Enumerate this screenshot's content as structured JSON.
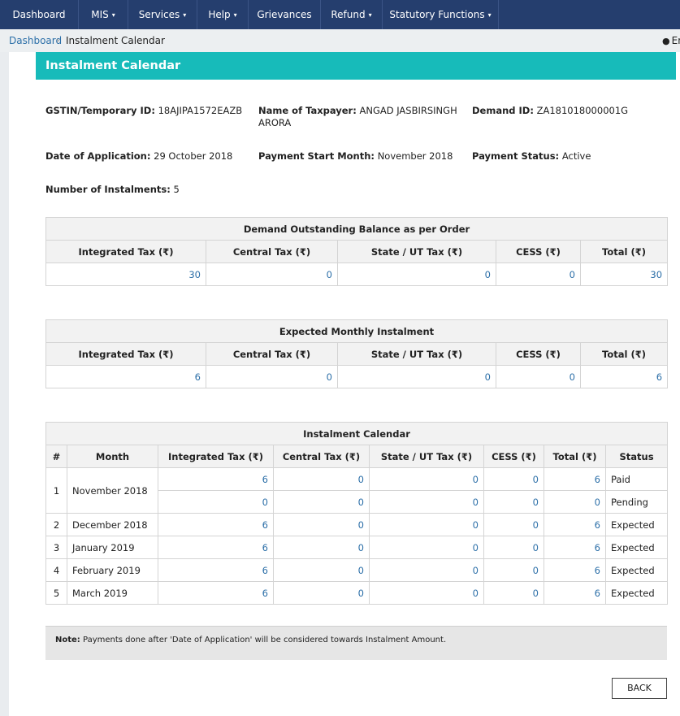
{
  "nav": {
    "items": [
      {
        "label": "Dashboard",
        "caret": false
      },
      {
        "label": "MIS",
        "caret": true
      },
      {
        "label": "Services",
        "caret": true
      },
      {
        "label": "Help",
        "caret": true
      },
      {
        "label": "Grievances",
        "caret": false
      },
      {
        "label": "Refund",
        "caret": true
      },
      {
        "label": "Statutory Functions",
        "caret": true
      }
    ],
    "caret_glyph": "▾"
  },
  "breadcrumb": {
    "link": "Dashboard",
    "separator": "›",
    "current": "Instalment Calendar"
  },
  "language": {
    "label": "En"
  },
  "page_title": "Instalment Calendar",
  "details": {
    "gstin": {
      "label": "GSTIN/Temporary ID:",
      "value": "18AJIPA1572EAZB"
    },
    "taxpayer": {
      "label": "Name of Taxpayer:",
      "value": "ANGAD JASBIRSINGH ARORA"
    },
    "demand_id": {
      "label": "Demand ID:",
      "value": "ZA181018000001G"
    },
    "date_of_application": {
      "label": "Date of Application:",
      "value": "29 October 2018"
    },
    "payment_start_month": {
      "label": "Payment Start Month:",
      "value": "November 2018"
    },
    "payment_status": {
      "label": "Payment Status:",
      "value": "Active"
    },
    "number_of_instalments": {
      "label": "Number of Instalments:",
      "value": "5"
    }
  },
  "tax_columns": [
    "Integrated Tax (₹)",
    "Central Tax (₹)",
    "State / UT Tax (₹)",
    "CESS (₹)",
    "Total (₹)"
  ],
  "outstanding": {
    "title": "Demand Outstanding Balance as per Order",
    "values": [
      "30",
      "0",
      "0",
      "0",
      "30"
    ]
  },
  "monthly": {
    "title": "Expected Monthly Instalment",
    "values": [
      "6",
      "0",
      "0",
      "0",
      "6"
    ]
  },
  "calendar": {
    "title": "Instalment Calendar",
    "columns": [
      "#",
      "Month",
      "Integrated Tax (₹)",
      "Central Tax (₹)",
      "State / UT Tax (₹)",
      "CESS (₹)",
      "Total (₹)",
      "Status"
    ],
    "rows": [
      {
        "no": "1",
        "month": "November 2018",
        "entries": [
          {
            "values": [
              "6",
              "0",
              "0",
              "0",
              "6"
            ],
            "status": "Paid"
          },
          {
            "values": [
              "0",
              "0",
              "0",
              "0",
              "0"
            ],
            "status": "Pending"
          }
        ]
      },
      {
        "no": "2",
        "month": "December 2018",
        "entries": [
          {
            "values": [
              "6",
              "0",
              "0",
              "0",
              "6"
            ],
            "status": "Expected"
          }
        ]
      },
      {
        "no": "3",
        "month": "January 2019",
        "entries": [
          {
            "values": [
              "6",
              "0",
              "0",
              "0",
              "6"
            ],
            "status": "Expected"
          }
        ]
      },
      {
        "no": "4",
        "month": "February 2019",
        "entries": [
          {
            "values": [
              "6",
              "0",
              "0",
              "0",
              "6"
            ],
            "status": "Expected"
          }
        ]
      },
      {
        "no": "5",
        "month": "March 2019",
        "entries": [
          {
            "values": [
              "6",
              "0",
              "0",
              "0",
              "6"
            ],
            "status": "Expected"
          }
        ]
      }
    ]
  },
  "note": {
    "label": "Note:",
    "text": "Payments done after 'Date of Application' will be considered towards Instalment Amount."
  },
  "back_button": "BACK"
}
